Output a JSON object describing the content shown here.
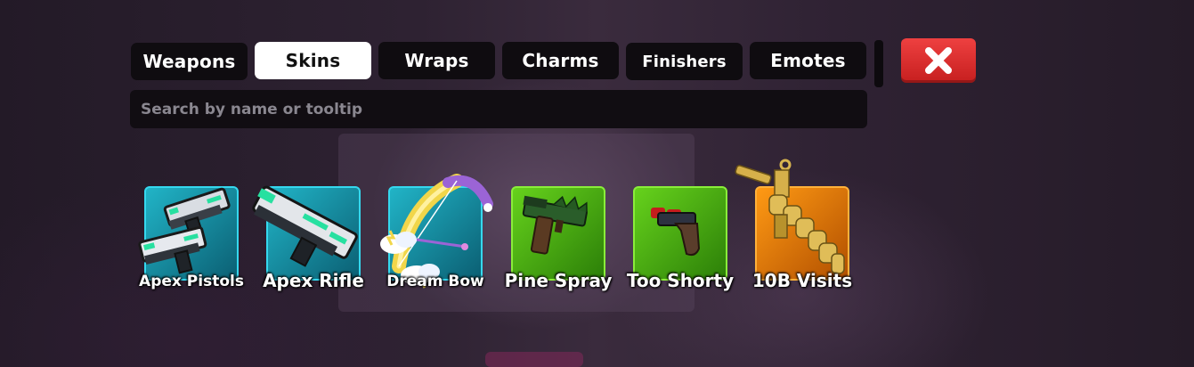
{
  "tabs": [
    {
      "label": "Weapons",
      "active": false
    },
    {
      "label": "Skins",
      "active": true
    },
    {
      "label": "Wraps",
      "active": false
    },
    {
      "label": "Charms",
      "active": false
    },
    {
      "label": "Finishers",
      "active": false
    },
    {
      "label": "Emotes",
      "active": false
    }
  ],
  "close_icon": "close-x-icon",
  "search": {
    "placeholder": "Search by name or tooltip",
    "value": ""
  },
  "items": [
    {
      "name": "Apex Pistols",
      "rarity_color": "#21b4c7",
      "icon": "apex-pistols-icon"
    },
    {
      "name": "Apex Rifle",
      "rarity_color": "#21b4c7",
      "icon": "apex-rifle-icon"
    },
    {
      "name": "Dream Bow",
      "rarity_color": "#21b4c7",
      "icon": "dream-bow-icon"
    },
    {
      "name": "Pine Spray",
      "rarity_color": "#66d21c",
      "icon": "pine-spray-icon"
    },
    {
      "name": "Too Shorty",
      "rarity_color": "#66d21c",
      "icon": "too-shorty-icon"
    },
    {
      "name": "10B Visits",
      "rarity_color": "#ff9a14",
      "icon": "10b-visits-icon"
    }
  ]
}
